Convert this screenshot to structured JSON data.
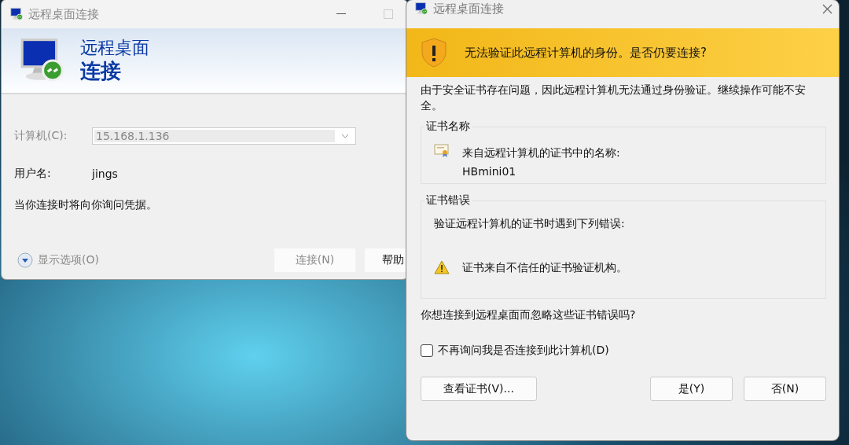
{
  "main_window": {
    "title": "远程桌面连接",
    "banner": {
      "line_1": "远程桌面",
      "line_2": "连接"
    },
    "fields": [
      {
        "label": "计算机(C):",
        "value": "15.168.1.136",
        "kind": "combo",
        "disabled": true
      },
      {
        "label": "用户名:",
        "value": "jings",
        "kind": "text",
        "disabled": false
      }
    ],
    "note": "当你连接时将向你询问凭据。",
    "options_toggle": {
      "label": "显示选项(O)",
      "disabled": true
    },
    "buttons": [
      {
        "label": "连接(N)",
        "disabled": true
      },
      {
        "label": "帮助",
        "disabled": false
      }
    ]
  },
  "dialog": {
    "title": "远程桌面连接",
    "warning": "无法验证此远程计算机的身份。是否仍要连接?",
    "intro": "由于安全证书存在问题，因此远程计算机无法通过身份验证。继续操作可能不安全。",
    "groups": [
      {
        "title": "证书名称",
        "items": [
          {
            "kind": "certificate",
            "lines": [
              "来自远程计算机的证书中的名称:",
              "HBmini01"
            ]
          }
        ]
      },
      {
        "title": "证书错误",
        "header": "验证远程计算机的证书时遇到下列错误:",
        "items": [
          {
            "kind": "warning",
            "lines": [
              "证书来自不信任的证书验证机构。"
            ]
          }
        ]
      }
    ],
    "question": "你想连接到远程桌面而忽略这些证书错误吗?",
    "checkbox": {
      "label": "不再询问我是否连接到此计算机(D)",
      "checked": false
    },
    "buttons": [
      {
        "label": "查看证书(V)...",
        "kind": "left"
      },
      {
        "label": "是(Y)",
        "kind": "right"
      },
      {
        "label": "否(N)",
        "kind": "right"
      }
    ]
  }
}
